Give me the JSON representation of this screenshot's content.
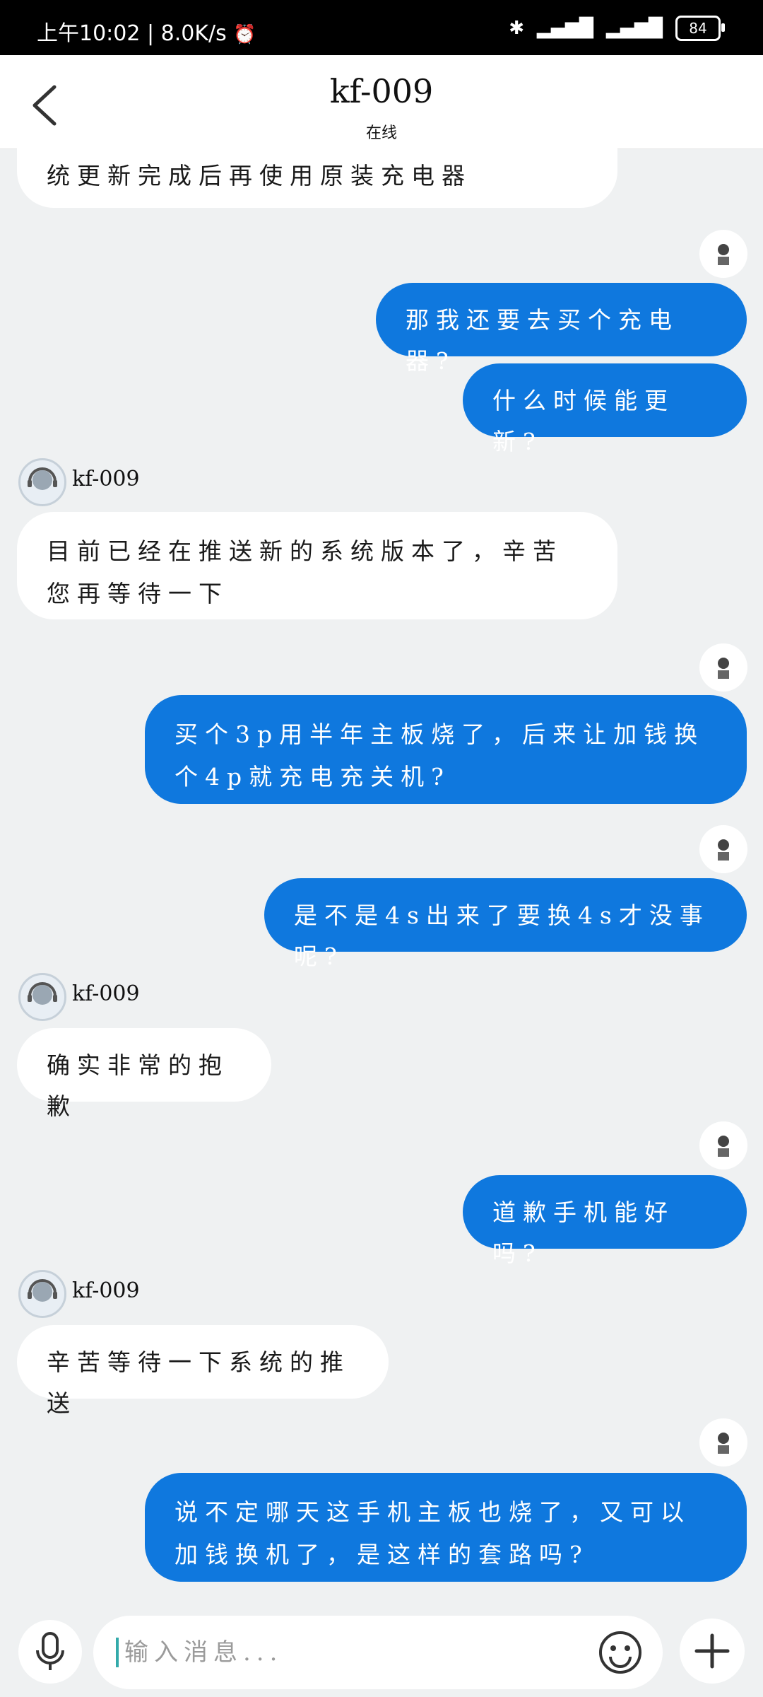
{
  "status_bar": {
    "time": "上午10:02",
    "speed": "8.0K/s",
    "battery": "84"
  },
  "header": {
    "title": "kf-009",
    "status": "在线"
  },
  "messages": [
    {
      "side": "in",
      "text": "统更新完成后再使用原装充电器"
    },
    {
      "side": "out",
      "text": "那我还要去买个充电器?"
    },
    {
      "side": "out",
      "text": "什么时候能更新?"
    },
    {
      "side": "agent_name",
      "text": "kf-009"
    },
    {
      "side": "in",
      "text": "目前已经在推送新的系统版本了，辛苦您再等待一下"
    },
    {
      "side": "out",
      "text": "买个3p用半年主板烧了，后来让加钱换个4p就充电充关机?"
    },
    {
      "side": "out",
      "text": "是不是4s出来了要换4s才没事呢?"
    },
    {
      "side": "agent_name",
      "text": "kf-009"
    },
    {
      "side": "in",
      "text": "确实非常的抱歉"
    },
    {
      "side": "out",
      "text": "道歉手机能好吗?"
    },
    {
      "side": "agent_name",
      "text": "kf-009"
    },
    {
      "side": "in",
      "text": "辛苦等待一下系统的推送"
    },
    {
      "side": "out",
      "text": "说不定哪天这手机主板也烧了，又可以加钱换机了，是这样的套路吗?"
    }
  ],
  "input": {
    "placeholder": "输入消息..."
  },
  "colors": {
    "accent": "#0f78de",
    "background": "#eff1f2"
  }
}
